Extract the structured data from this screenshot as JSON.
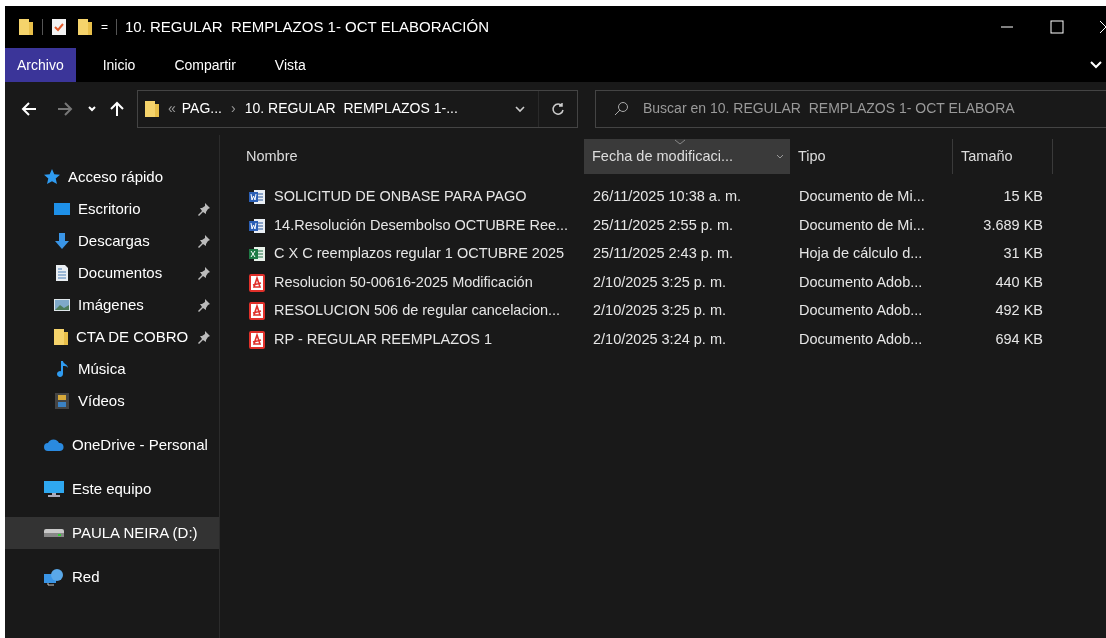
{
  "window": {
    "title": "10. REGULAR  REMPLAZOS 1- OCT ELABORACIÓN",
    "quick_access_separator": "="
  },
  "ribbon_tabs": [
    {
      "label": "Archivo",
      "selected": true
    },
    {
      "label": "Inicio",
      "selected": false
    },
    {
      "label": "Compartir",
      "selected": false
    },
    {
      "label": "Vista",
      "selected": false
    }
  ],
  "address_bar": {
    "overflow": "«",
    "crumbs": [
      "PAG...",
      "10. REGULAR  REMPLAZOS 1-..."
    ],
    "separator": "›"
  },
  "search": {
    "placeholder": "Buscar en 10. REGULAR  REMPLAZOS 1- OCT ELABORA"
  },
  "sidebar": {
    "items": [
      {
        "label": "Acceso rápido",
        "kind": "star",
        "selected": false,
        "children": [
          {
            "label": "Escritorio",
            "kind": "desktop",
            "pinned": true,
            "selected": false
          },
          {
            "label": "Descargas",
            "kind": "download",
            "pinned": true,
            "selected": false
          },
          {
            "label": "Documentos",
            "kind": "documents",
            "pinned": true,
            "selected": false
          },
          {
            "label": "Imágenes",
            "kind": "pictures",
            "pinned": true,
            "selected": false
          },
          {
            "label": "CTA DE COBRO",
            "kind": "folder",
            "pinned": true,
            "selected": false
          },
          {
            "label": "Música",
            "kind": "music",
            "pinned": false,
            "selected": false
          },
          {
            "label": "Vídeos",
            "kind": "videos",
            "pinned": false,
            "selected": false
          }
        ]
      },
      {
        "label": "OneDrive - Personal",
        "kind": "cloud",
        "selected": false
      },
      {
        "label": "Este equipo",
        "kind": "computer",
        "selected": false
      },
      {
        "label": "PAULA NEIRA (D:)",
        "kind": "drive",
        "selected": true
      },
      {
        "label": "Red",
        "kind": "network",
        "selected": false
      }
    ]
  },
  "table": {
    "columns": [
      {
        "label": "Nombre",
        "sorted": false
      },
      {
        "label": "Fecha de modificaci...",
        "sorted": true
      },
      {
        "label": "Tipo",
        "sorted": false
      },
      {
        "label": "Tamaño",
        "sorted": false
      }
    ],
    "rows": [
      {
        "kind": "word",
        "name": "SOLICITUD DE ONBASE PARA PAGO",
        "date": "26/11/2025 10:38 a. m.",
        "type": "Documento de Mi...",
        "size": "15 KB"
      },
      {
        "kind": "word",
        "name": "14.Resolución Desembolso OCTUBRE Ree...",
        "date": "25/11/2025 2:55 p. m.",
        "type": "Documento de Mi...",
        "size": "3.689 KB"
      },
      {
        "kind": "excel",
        "name": "C X C reemplazos regular 1 OCTUBRE 2025",
        "date": "25/11/2025 2:43 p. m.",
        "type": "Hoja de cálculo d...",
        "size": "31 KB"
      },
      {
        "kind": "pdf",
        "name": "Resolucion 50-00616-2025 Modificación",
        "date": "2/10/2025 3:25 p. m.",
        "type": "Documento Adob...",
        "size": "440 KB"
      },
      {
        "kind": "pdf",
        "name": "RESOLUCION 506 de regular cancelacion...",
        "date": "2/10/2025 3:25 p. m.",
        "type": "Documento Adob...",
        "size": "492 KB"
      },
      {
        "kind": "pdf",
        "name": "RP - REGULAR REEMPLAZOS 1",
        "date": "2/10/2025 3:24 p. m.",
        "type": "Documento Adob...",
        "size": "694 KB"
      }
    ]
  }
}
